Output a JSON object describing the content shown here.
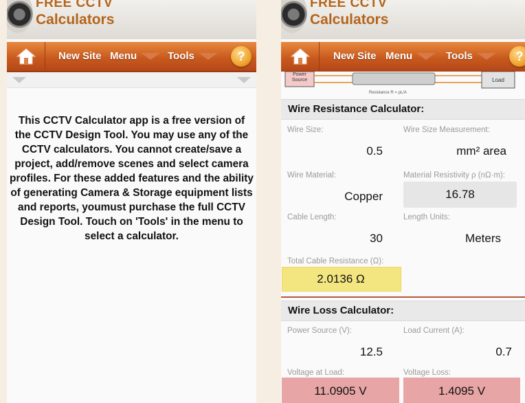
{
  "brand": {
    "title_top": "FREE CCTV",
    "title_sub": "Calculators"
  },
  "nav": {
    "new_site": "New Site",
    "menu": "Menu",
    "tools": "Tools",
    "help": "?"
  },
  "colors": {
    "nav_orange": "#c95a1e",
    "brand_orange": "#b4641c",
    "yellow_result": "#f3e680",
    "red_result": "#e7a5a5"
  },
  "intro_text": "This CCTV Calculator app is a free version of the CCTV Design Tool. You may use any of the CCTV calculators. You cannot create/save a project, add/remove scenes and select camera profiles. For these added features and the ability of generating Camera & Storage equipment lists and reports, youmust purchase the full CCTV Design Tool. Touch on 'Tools' in the menu to select a calculator.",
  "diagram": {
    "power_source": "Power Source",
    "load": "Load",
    "resistance": "Resistance R = ρL/A"
  },
  "wire_resistance": {
    "heading": "Wire Resistance Calculator:",
    "wire_size_label": "Wire Size:",
    "wire_size_value": "0.5",
    "wire_size_measurement_label": "Wire Size Measurement:",
    "wire_size_measurement_value": "mm² area",
    "wire_material_label": "Wire Material:",
    "wire_material_value": "Copper",
    "resistivity_label": "Material Resistivity ρ (nΩ·m):",
    "resistivity_value": "16.78",
    "cable_length_label": "Cable Length:",
    "cable_length_value": "30",
    "length_units_label": "Length Units:",
    "length_units_value": "Meters",
    "total_label": "Total Cable Resistance (Ω):",
    "total_value": "2.0136 Ω"
  },
  "wire_loss": {
    "heading": "Wire Loss Calculator:",
    "power_source_label": "Power Source (V):",
    "power_source_value": "12.5",
    "load_current_label": "Load Current (A):",
    "load_current_value": "0.7",
    "voltage_at_load_label": "Voltage at Load:",
    "voltage_at_load_value": "11.0905 V",
    "voltage_loss_label": "Voltage Loss:",
    "voltage_loss_value": "1.4095 V"
  }
}
